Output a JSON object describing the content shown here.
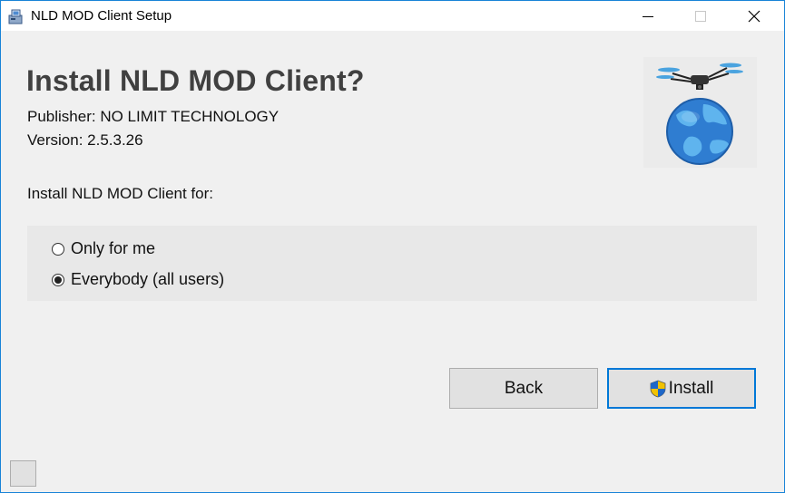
{
  "window": {
    "title": "NLD MOD Client Setup",
    "accent": "#1883d7"
  },
  "icons": {
    "app": "installer-app-icon",
    "minimize": "minimize-icon",
    "maximize": "maximize-icon",
    "close": "close-icon",
    "logo": "drone-globe-logo",
    "shield": "uac-shield-icon"
  },
  "main": {
    "heading": "Install NLD MOD Client?",
    "publisher": "Publisher: NO LIMIT TECHNOLOGY",
    "version": "Version: 2.5.3.26",
    "install_for_label": "Install NLD MOD Client for:"
  },
  "scope_options": [
    {
      "label": "Only for me",
      "selected": false
    },
    {
      "label": "Everybody (all users)",
      "selected": true
    }
  ],
  "buttons": {
    "back_label": "Back",
    "install_label": "Install"
  }
}
